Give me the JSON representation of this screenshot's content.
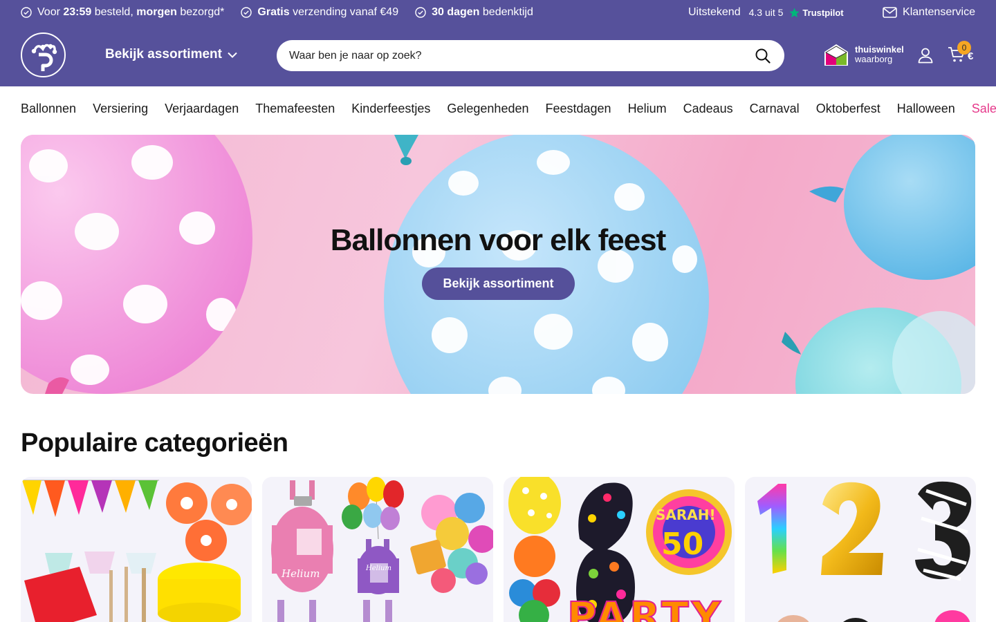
{
  "usp": [
    {
      "pre": "Voor ",
      "b1": "23:59",
      "mid": " besteld, ",
      "b2": "morgen",
      "post": " bezorgd*"
    },
    {
      "pre": "",
      "b1": "Gratis",
      "mid": " verzending vanaf €49",
      "b2": "",
      "post": ""
    },
    {
      "pre": "",
      "b1": "30 dagen",
      "mid": " bedenktijd",
      "b2": "",
      "post": ""
    }
  ],
  "trust": {
    "label": "Uitstekend",
    "score": "4.3 uit 5",
    "brand": "Trustpilot"
  },
  "service": {
    "label": "Klantenservice",
    "icon": "mail-icon"
  },
  "header": {
    "assortment_label": "Bekijk assortiment",
    "search_placeholder": "Waar ben je naar op zoek?",
    "thuiswinkel_line1": "thuiswinkel",
    "thuiswinkel_line2": "waarborg",
    "cart_count": "0",
    "cart_amount": "€"
  },
  "nav": [
    "Ballonnen",
    "Versiering",
    "Verjaardagen",
    "Themafeesten",
    "Kinderfeestjes",
    "Gelegenheden",
    "Feestdagen",
    "Helium",
    "Cadeaus",
    "Carnaval",
    "Oktoberfest",
    "Halloween",
    "Sale"
  ],
  "hero": {
    "title": "Ballonnen voor elk feest",
    "cta": "Bekijk assortiment"
  },
  "popular": {
    "title": "Populaire categorieën",
    "cards": [
      {
        "image_text": ""
      },
      {
        "image_text": "Helium"
      },
      {
        "image_text": "PARTY"
      },
      {
        "image_text": ""
      }
    ]
  },
  "colors": {
    "brand": "#56519b",
    "sale": "#e6398b",
    "badge": "#f5a623",
    "trustpilot": "#00b67a"
  }
}
